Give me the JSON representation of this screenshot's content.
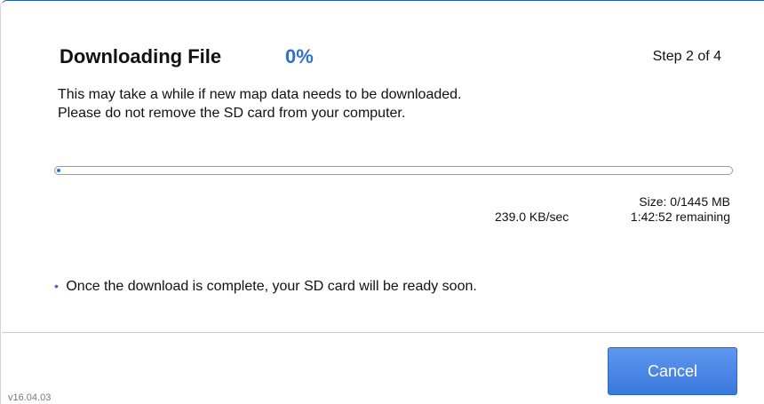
{
  "header": {
    "title": "Downloading File",
    "percent": "0%",
    "step": "Step 2 of 4"
  },
  "description": {
    "line1": "This may take a while if new map data needs to be downloaded.",
    "line2": "Please do not remove the SD card from your computer."
  },
  "progress": {
    "fraction": 0.0,
    "size": "Size: 0/1445 MB",
    "rate": "239.0 KB/sec",
    "remaining": "1:42:52 remaining"
  },
  "note": {
    "bullet": "•",
    "text": "Once the download is complete, your SD card will be ready soon."
  },
  "footer": {
    "cancel_label": "Cancel",
    "version": "v16.04.03"
  },
  "colors": {
    "accent": "#2f6fd0",
    "button": "#3b78dc"
  }
}
